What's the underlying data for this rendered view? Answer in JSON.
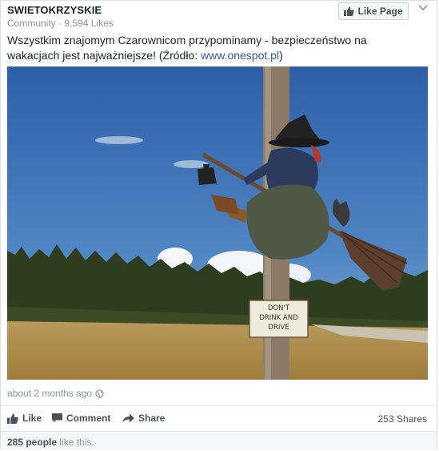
{
  "page": {
    "name": "SWIETOKRZYSKIE",
    "category": "Community",
    "separator": " · ",
    "likes_count": "9,594 Likes",
    "like_button_label": "Like Page"
  },
  "post": {
    "text_main": "Wszystkim znajomym Czarownicom przypominamy - bezpieczeństwo na wakacjach jest najważniejsze! (Źródło: ",
    "link_text": "www.onespot.pl",
    "text_end": ")",
    "timestamp": "about 2 months ago",
    "sign_text": [
      "DON'T",
      "DRINK AND",
      "DRIVE"
    ]
  },
  "actions": {
    "like": "Like",
    "comment": "Comment",
    "share": "Share",
    "shares_count": "253 Shares"
  },
  "reactions": {
    "people_count": "285 people",
    "suffix": " like this."
  },
  "icons": {
    "like": "thumbs-up-icon",
    "comment": "speech-bubble-icon",
    "share": "share-arrow-icon",
    "privacy": "globe-icon",
    "menu": "chevron-down-icon"
  },
  "colors": {
    "link": "#365899",
    "muted": "#90949c",
    "action_text": "#4b4f56"
  }
}
